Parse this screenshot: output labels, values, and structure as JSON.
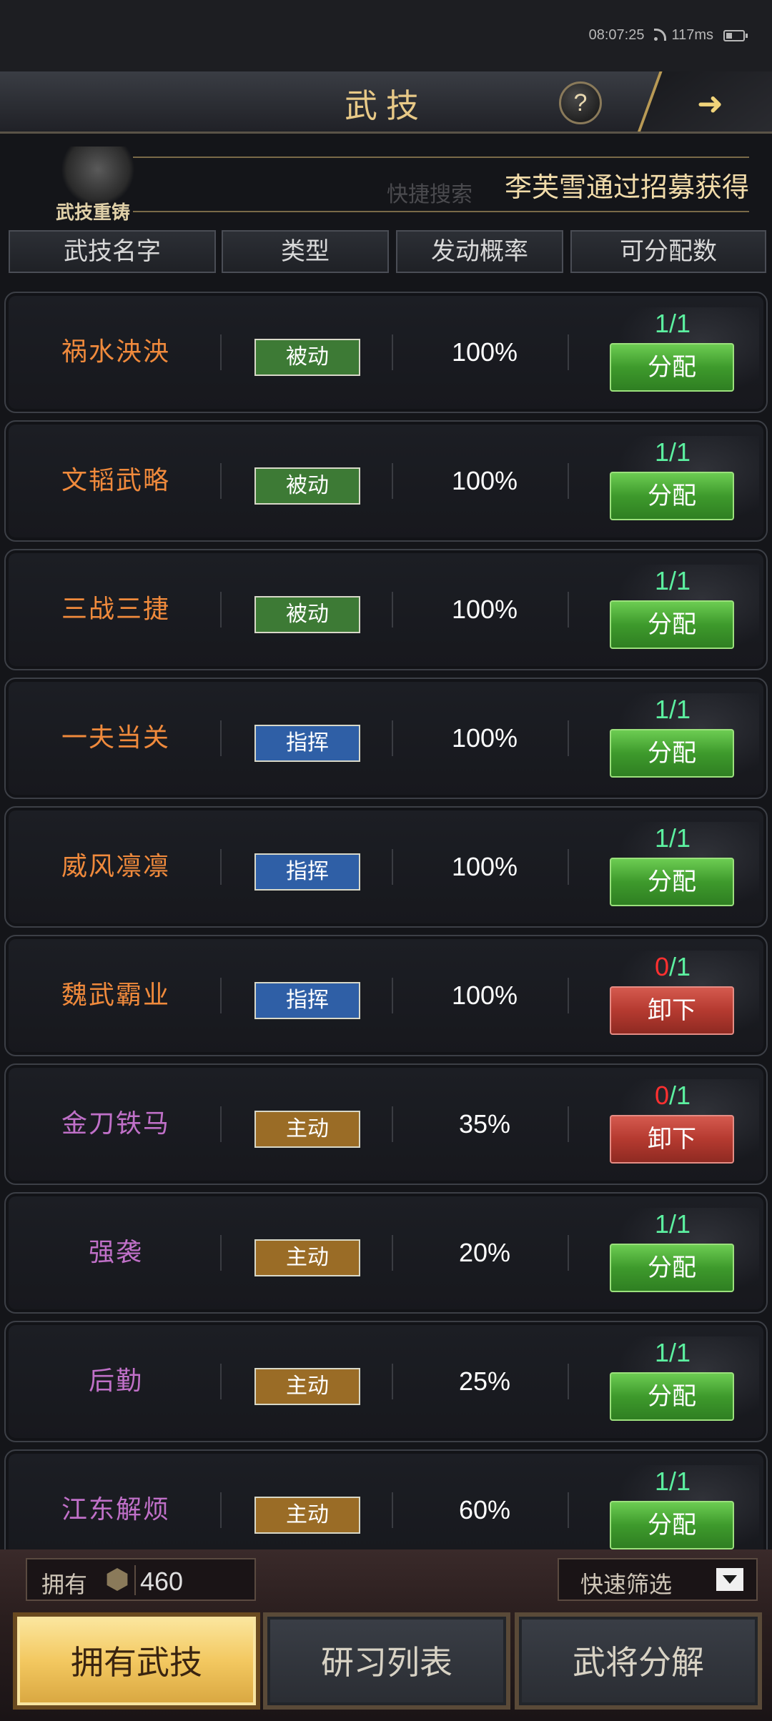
{
  "status": {
    "time": "08:07:25",
    "latency": "117ms"
  },
  "title": "武技",
  "help_label": "?",
  "reforge_label": "武技重铸",
  "search_placeholder": "快捷搜索",
  "marquee": "李芙雪通过招募获得",
  "headers": [
    "武技名字",
    "类型",
    "发动概率",
    "可分配数"
  ],
  "rows": [
    {
      "name": "祸水泱泱",
      "name_color": "#f08a3c",
      "type": "被动",
      "type_color": "#3d7a35",
      "prob": "100%",
      "have": "1",
      "slash": "/",
      "total": "1",
      "count_state": "ok",
      "action": "分配",
      "action_kind": "green"
    },
    {
      "name": "文韬武略",
      "name_color": "#f08a3c",
      "type": "被动",
      "type_color": "#3d7a35",
      "prob": "100%",
      "have": "1",
      "slash": "/",
      "total": "1",
      "count_state": "ok",
      "action": "分配",
      "action_kind": "green"
    },
    {
      "name": "三战三捷",
      "name_color": "#f08a3c",
      "type": "被动",
      "type_color": "#3d7a35",
      "prob": "100%",
      "have": "1",
      "slash": "/",
      "total": "1",
      "count_state": "ok",
      "action": "分配",
      "action_kind": "green"
    },
    {
      "name": "一夫当关",
      "name_color": "#f08a3c",
      "type": "指挥",
      "type_color": "#2f5fa6",
      "prob": "100%",
      "have": "1",
      "slash": "/",
      "total": "1",
      "count_state": "ok",
      "action": "分配",
      "action_kind": "green"
    },
    {
      "name": "威风凛凛",
      "name_color": "#f08a3c",
      "type": "指挥",
      "type_color": "#2f5fa6",
      "prob": "100%",
      "have": "1",
      "slash": "/",
      "total": "1",
      "count_state": "ok",
      "action": "分配",
      "action_kind": "green"
    },
    {
      "name": "魏武霸业",
      "name_color": "#f08a3c",
      "type": "指挥",
      "type_color": "#2f5fa6",
      "prob": "100%",
      "have": "0",
      "slash": "/",
      "total": "1",
      "count_state": "bad",
      "action": "卸下",
      "action_kind": "red"
    },
    {
      "name": "金刀铁马",
      "name_color": "#c070c8",
      "type": "主动",
      "type_color": "#9a6c26",
      "prob": "35%",
      "have": "0",
      "slash": "/",
      "total": "1",
      "count_state": "bad",
      "action": "卸下",
      "action_kind": "red"
    },
    {
      "name": "强袭",
      "name_color": "#c070c8",
      "type": "主动",
      "type_color": "#9a6c26",
      "prob": "20%",
      "have": "1",
      "slash": "/",
      "total": "1",
      "count_state": "ok",
      "action": "分配",
      "action_kind": "green"
    },
    {
      "name": "后勤",
      "name_color": "#c070c8",
      "type": "主动",
      "type_color": "#9a6c26",
      "prob": "25%",
      "have": "1",
      "slash": "/",
      "total": "1",
      "count_state": "ok",
      "action": "分配",
      "action_kind": "green"
    },
    {
      "name": "江东解烦",
      "name_color": "#c070c8",
      "type": "主动",
      "type_color": "#9a6c26",
      "prob": "60%",
      "have": "1",
      "slash": "/",
      "total": "1",
      "count_state": "ok",
      "action": "分配",
      "action_kind": "green"
    }
  ],
  "owned": {
    "label": "拥有",
    "value": "460"
  },
  "filter_label": "快速筛选",
  "tabs": [
    "拥有武技",
    "研习列表",
    "武将分解"
  ],
  "active_tab": 0
}
